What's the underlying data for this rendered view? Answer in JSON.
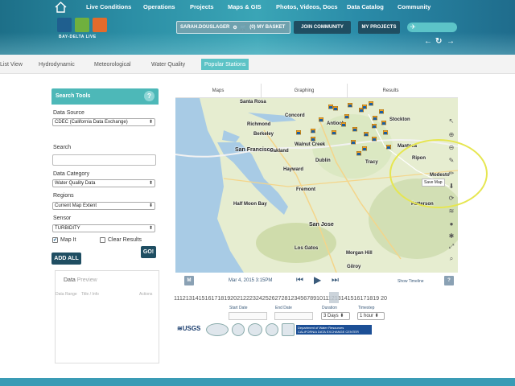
{
  "header": {
    "nav": [
      "Live Conditions",
      "Operations",
      "Projects",
      "Maps & GIS",
      "Photos, Videos, Docs",
      "Data Catalog",
      "Community"
    ],
    "logo_text": "BAY-DELTA LIVE",
    "user_label": "SARAH.DOUSLAGER",
    "basket_label": "(0) MY BASKET",
    "join_label": "JOIN COMMUNITY",
    "projects_label": "MY PROJECTS"
  },
  "subnav": {
    "tabs": [
      "List View",
      "Hydrodynamic",
      "Meteorological",
      "Water Quality",
      "Popular Stations"
    ],
    "active": "Popular Stations"
  },
  "search_tools": {
    "title": "Search Tools",
    "help": "?",
    "data_source_label": "Data Source",
    "data_source_value": "CDEC (California Data Exchange)",
    "search_label": "Search",
    "search_value": "",
    "category_label": "Data Category",
    "category_value": "Water Quality Data",
    "regions_label": "Regions",
    "regions_value": "Current Map Extent",
    "sensor_label": "Sensor",
    "sensor_value": "TURBIDITY",
    "map_it_label": "Map It",
    "map_it_checked": true,
    "clear_results_label": "Clear Results",
    "clear_results_checked": false,
    "go_label": "GO!",
    "add_all_label": "ADD ALL"
  },
  "data_preview": {
    "title_dark": "Data",
    "title_light": "Preview",
    "col1": "Data Range",
    "col2": "Title / Info",
    "col3": "Actions"
  },
  "map": {
    "tabs": [
      "Maps",
      "Graphing",
      "Results"
    ],
    "cities": [
      "Santa Rosa",
      "Concord",
      "Richmond",
      "Berkeley",
      "Antioch",
      "Walnut Creek",
      "Oakland",
      "San Francisco",
      "Dublin",
      "Hayward",
      "Fremont",
      "Half Moon Bay",
      "San Jose",
      "Stockton",
      "Tracy",
      "Manteca",
      "Ripon",
      "Modesto",
      "Patterson",
      "Gilroy",
      "Morgan Hill",
      "Los Gatos"
    ],
    "tooltip": "Save Map"
  },
  "timeline": {
    "date": "Mar 4, 2015 3:15PM",
    "show_timeline": "Show Timeline",
    "m_label": "M",
    "help": "?",
    "numbers": "11121314151617181920212223242526272812345678910111213141516171819 20",
    "start_date_label": "Start Date",
    "end_date_label": "End Date",
    "duration_label": "Duration",
    "duration_value": "3 Days",
    "timestep_label": "Timestep",
    "timestep_value": "1 hour"
  },
  "partners": {
    "usgs": "≋USGS",
    "cdec_line1": "Department of Water Resources",
    "cdec_line2": "CALIFORNIA DATA EXCHANGE CENTER"
  },
  "colors": {
    "teal": "#4db8b8",
    "dark_button": "#1f4e62",
    "highlight": "#e6e650"
  }
}
